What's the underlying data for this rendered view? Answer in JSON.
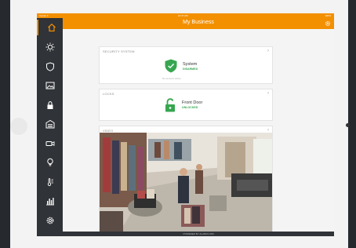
{
  "device": {
    "status_carrier": "Carrier ▾",
    "status_time": "10:37 AM",
    "status_battery": "100%"
  },
  "header": {
    "title": "My Business"
  },
  "sidebar": {
    "items": [
      {
        "icon": "home-icon",
        "active": true
      },
      {
        "icon": "lightbulb-rays-icon"
      },
      {
        "icon": "shield-icon"
      },
      {
        "icon": "image-icon"
      },
      {
        "icon": "lock-icon"
      },
      {
        "icon": "garage-icon"
      },
      {
        "icon": "video-camera-icon"
      },
      {
        "icon": "lightbulb-icon"
      },
      {
        "icon": "thermostat-icon"
      },
      {
        "icon": "bar-chart-icon"
      },
      {
        "icon": "settings-icon"
      }
    ]
  },
  "security": {
    "label": "SECURITY SYSTEM",
    "name": "System",
    "status": "DISARMED",
    "footer": "No sensors active"
  },
  "locks": {
    "label": "LOCKS",
    "name": "Front Door",
    "status": "UNLOCKED"
  },
  "video": {
    "label": "VIDEO"
  },
  "footer": {
    "brand": "POWERED BY ALARM.COM"
  },
  "colors": {
    "accent": "#f39000",
    "sidebar": "#303337",
    "status_ok": "#37a651"
  }
}
